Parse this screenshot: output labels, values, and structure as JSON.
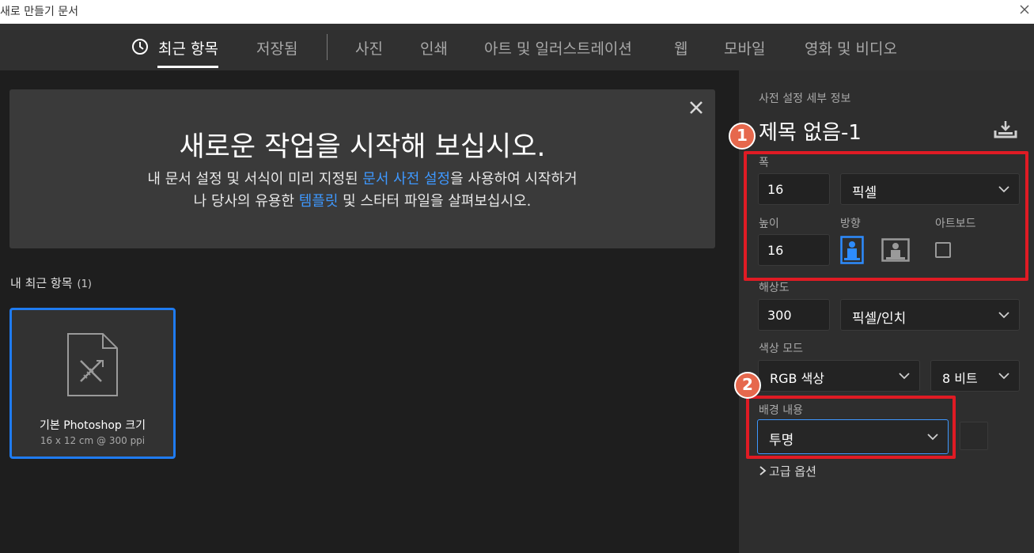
{
  "window": {
    "title": "새로 만들기 문서"
  },
  "nav": {
    "tabs": [
      {
        "label": "최근 항목"
      },
      {
        "label": "저장됨"
      },
      {
        "label": "사진"
      },
      {
        "label": "인쇄"
      },
      {
        "label": "아트 및 일러스트레이션"
      },
      {
        "label": "웹"
      },
      {
        "label": "모바일"
      },
      {
        "label": "영화 및 비디오"
      }
    ]
  },
  "banner": {
    "heading": "새로운 작업을 시작해 보십시오.",
    "line1_pre": "내 문서 설정 및 서식이 미리 지정된 ",
    "line1_link": "문서 사전 설정",
    "line1_post": "을 사용하여 시작하거",
    "line2_pre": "나 당사의 유용한 ",
    "line2_link": "템플릿",
    "line2_post": " 및 스타터 파일을 살펴보십시오."
  },
  "recent": {
    "title": "내 최근 항목",
    "count": "(1)",
    "items": [
      {
        "name": "기본 Photoshop 크기",
        "meta": "16 x 12 cm @ 300 ppi"
      }
    ]
  },
  "preset": {
    "section_label": "사전 설정 세부 정보",
    "doc_title": "제목 없음-1",
    "width_label": "폭",
    "width_value": "16",
    "width_unit": "픽셀",
    "height_label": "높이",
    "height_value": "16",
    "orientation_label": "방향",
    "artboard_label": "아트보드",
    "resolution_label": "해상도",
    "resolution_value": "300",
    "resolution_unit": "픽셀/인치",
    "color_mode_label": "색상 모드",
    "color_mode_value": "RGB 색상",
    "bit_depth_value": "8 비트",
    "background_label": "배경 내용",
    "background_value": "투명",
    "advanced_label": "고급 옵션"
  },
  "annotations": {
    "badge1": "1",
    "badge2": "2"
  },
  "colors": {
    "accent": "#3e98ff",
    "card_border": "#1f7bf0",
    "annotation_red": "#e01b24",
    "badge": "#e6684d"
  }
}
